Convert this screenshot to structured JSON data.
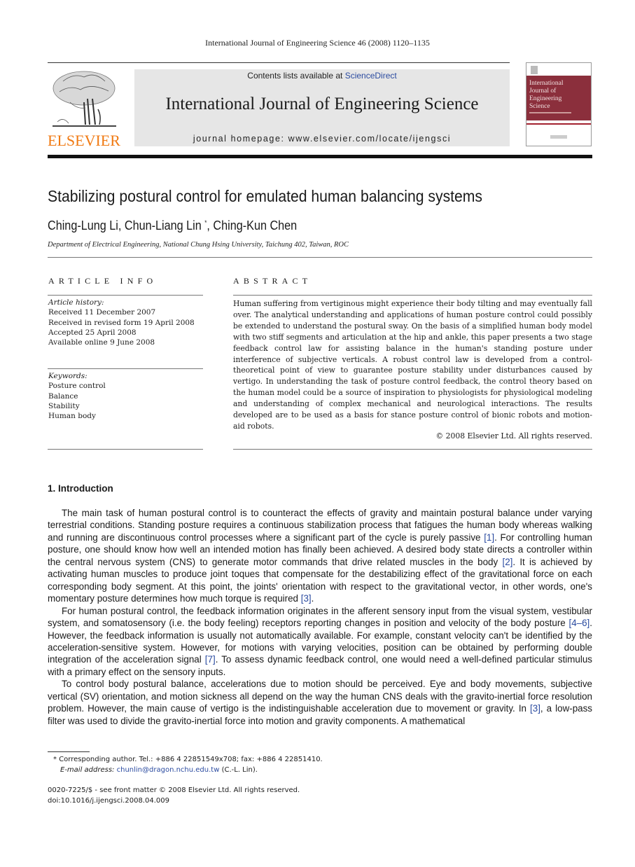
{
  "running_head": "International Journal of Engineering Science 46 (2008) 1120–1135",
  "masthead": {
    "publisher_logo": "ELSEVIER",
    "contents_prefix": "Contents lists available at ",
    "contents_link": "ScienceDirect",
    "journal_title": "International Journal of Engineering Science",
    "homepage": "journal homepage: www.elsevier.com/locate/ijengsci",
    "cover_title_lines": [
      "International",
      "Journal of",
      "Engineering",
      "Science"
    ],
    "colors": {
      "elsevier_orange": "#f07a13",
      "cover_red": "#8b2f3c",
      "link_blue": "#2b4ba0",
      "banner_gray": "#e6e6e6"
    }
  },
  "article": {
    "title": "Stabilizing postural control for emulated human balancing systems",
    "authors_before": "Ching-Lung Li, Chun-Liang Lin ",
    "author_mark": "*",
    "authors_after": ", Ching-Kun Chen",
    "affiliation": "Department of Electrical Engineering, National Chung Hsing University, Taichung 402, Taiwan, ROC"
  },
  "article_info": {
    "heading": "ARTICLE INFO",
    "history_label": "Article history:",
    "history": [
      "Received 11 December 2007",
      "Received in revised form 19 April 2008",
      "Accepted 25 April 2008",
      "Available online 9 June 2008"
    ],
    "keywords_label": "Keywords:",
    "keywords": [
      "Posture control",
      "Balance",
      "Stability",
      "Human body"
    ]
  },
  "abstract": {
    "heading": "ABSTRACT",
    "text": "Human suffering from vertiginous might experience their body tilting and may eventually fall over. The analytical understanding and applications of human posture control could possibly be extended to understand the postural sway. On the basis of a simplified human body model with two stiff segments and articulation at the hip and ankle, this paper presents a two stage feedback control law for assisting balance in the human's standing posture under interference of subjective verticals. A robust control law is developed from a control-theoretical point of view to guarantee posture stability under disturbances caused by vertigo. In understanding the task of posture control feedback, the control theory based on the human model could be a source of inspiration to physiologists for physiological modeling and understanding of complex mechanical and neurological interactions. The results developed are to be used as a basis for stance posture control of bionic robots and motion-aid robots.",
    "copyright": "© 2008 Elsevier Ltd. All rights reserved."
  },
  "introduction": {
    "heading": "1. Introduction",
    "p1": [
      "The main task of human postural control is to counteract the effects of gravity and maintain postural balance under varying terrestrial conditions. Standing posture requires a continuous stabilization process that fatigues the human body whereas walking and running are discontinuous control processes where a significant part of the cycle is purely passive ",
      "[1]",
      ". For controlling human posture, one should know how well an intended motion has finally been achieved. A desired body state directs a controller within the central nervous system (CNS) to generate motor commands that drive related muscles in the body ",
      "[2]",
      ". It is achieved by activating human muscles to produce joint toques that compensate for the destabilizing effect of the gravitational force on each corresponding body segment. At this point, the joints' orientation with respect to the gravitational vector, in other words, one's momentary posture determines how much torque is required ",
      "[3]",
      "."
    ],
    "p2": [
      "For human postural control, the feedback information originates in the afferent sensory input from the visual system, vestibular system, and somatosensory (i.e. the body feeling) receptors reporting changes in position and velocity of the body posture ",
      "[4–6]",
      ". However, the feedback information is usually not automatically available. For example, constant velocity can't be identified by the acceleration-sensitive system. However, for motions with varying velocities, position can be obtained by performing double integration of the acceleration signal ",
      "[7]",
      ". To assess dynamic feedback control, one would need a well-defined particular stimulus with a primary effect on the sensory inputs."
    ],
    "p3": [
      "To control body postural balance, accelerations due to motion should be perceived. Eye and body movements, subjective vertical (SV) orientation, and motion sickness all depend on the way the human CNS deals with the gravito-inertial force resolution problem. However, the main cause of vertigo is the indistinguishable acceleration due to movement or gravity. In ",
      "[3]",
      ", a low-pass filter was used to divide the gravito-inertial force into motion and gravity components. A mathematical"
    ]
  },
  "footnote": {
    "mark": "*",
    "line1": " Corresponding author. Tel.: +886 4 22851549x708; fax: +886 4 22851410.",
    "email_label": "E-mail address:",
    "email": "chunlin@dragon.nchu.edu.tw",
    "email_suffix": " (C.-L. Lin)."
  },
  "front_matter": {
    "issn_line": "0020-7225/$ - see front matter © 2008 Elsevier Ltd. All rights reserved.",
    "doi": "doi:10.1016/j.ijengsci.2008.04.009"
  }
}
